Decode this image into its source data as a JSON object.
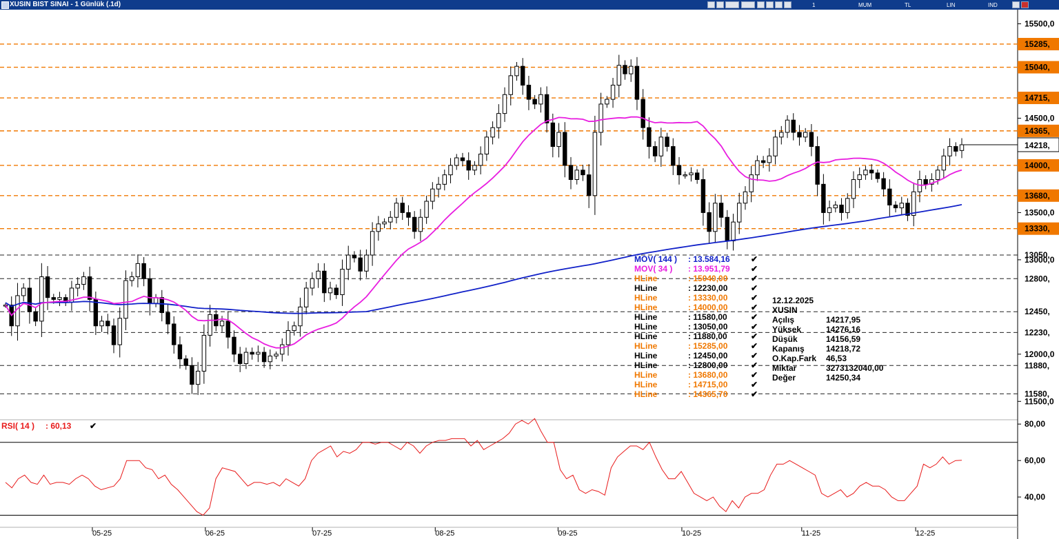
{
  "window": {
    "title": "XUSIN BIST SINAI - 1 Günlük (.1d)",
    "toolbar": {
      "period": "1 Günlük",
      "chart_type": "MUM",
      "currency": "TL",
      "scale": "LIN",
      "indicator_menu": "IND"
    }
  },
  "colors": {
    "mov144": "#1020c8",
    "mov34": "#e81ee0",
    "hline_orange": "#f07800",
    "hline_black": "#000000",
    "price_tag_orange": "#f07800",
    "rsi": "#e81a1a",
    "title_bar": "#0f3c8c"
  },
  "price_axis": {
    "ticks": [
      "15500,0",
      "14500,0",
      "13500,0",
      "13000,0",
      "12000,0",
      "11500,0"
    ],
    "last_price_tag": "14218,"
  },
  "hline_tags": [
    {
      "label": "15285,",
      "color": "orange"
    },
    {
      "label": "15040,",
      "color": "orange"
    },
    {
      "label": "14715,",
      "color": "orange"
    },
    {
      "label": "14365,",
      "color": "orange"
    },
    {
      "label": "14000,",
      "color": "orange"
    },
    {
      "label": "13680,",
      "color": "orange"
    },
    {
      "label": "13330,",
      "color": "orange"
    },
    {
      "label": "13050,",
      "color": "black"
    },
    {
      "label": "12800,",
      "color": "black"
    },
    {
      "label": "12450,",
      "color": "black"
    },
    {
      "label": "12230,",
      "color": "black"
    },
    {
      "label": "11880,",
      "color": "black"
    },
    {
      "label": "11580,",
      "color": "black"
    }
  ],
  "legend": [
    {
      "name": "MOV( 144 )",
      "value": ": 13.584,16",
      "color": "blue"
    },
    {
      "name": "MOV( 34 )",
      "value": ": 13.951,79",
      "color": "magenta"
    },
    {
      "name": "HLine",
      "value": ": 15040,00",
      "color": "orange"
    },
    {
      "name": "HLine",
      "value": ": 12230,00",
      "color": "black"
    },
    {
      "name": "HLine",
      "value": ": 13330,00",
      "color": "orange"
    },
    {
      "name": "HLine",
      "value": ": 14000,00",
      "color": "orange"
    },
    {
      "name": "HLine",
      "value": ": 11580,00",
      "color": "black"
    },
    {
      "name": "HLine",
      "value": ": 13050,00",
      "color": "black"
    },
    {
      "name": "HLine",
      "value": ": 11880,00",
      "color": "black"
    },
    {
      "name": "HLine",
      "value": ": 15285,00",
      "color": "orange"
    },
    {
      "name": "HLine",
      "value": ": 12450,00",
      "color": "black"
    },
    {
      "name": "HLine",
      "value": ": 12800,00",
      "color": "black"
    },
    {
      "name": "HLine",
      "value": ": 13680,00",
      "color": "orange"
    },
    {
      "name": "HLine",
      "value": ": 14715,00",
      "color": "orange"
    },
    {
      "name": "HLine",
      "value": ": 14365,70",
      "color": "orange"
    }
  ],
  "info_box": {
    "date": "12.12.2025",
    "symbol": "XUSIN",
    "rows": [
      {
        "label": "Açılış",
        "value": "14217,95"
      },
      {
        "label": "Yüksek",
        "value": "14276,16"
      },
      {
        "label": "Düşük",
        "value": "14156,59"
      },
      {
        "label": "Kapanış",
        "value": "14218,72"
      },
      {
        "label": "O.Kap.Fark",
        "value": "46,53"
      },
      {
        "label": "Miktar",
        "value": "3273132040,00"
      },
      {
        "label": "Değer",
        "value": "14250,34"
      }
    ]
  },
  "rsi_panel": {
    "label": "RSI( 14 )",
    "value": ": 60,13",
    "ticks": [
      "80,00",
      "60,00",
      "40,00"
    ]
  },
  "date_axis": [
    "05-25",
    "06-25",
    "07-25",
    "08-25",
    "09-25",
    "10-25",
    "11-25",
    "12-25"
  ],
  "chart_data": {
    "type": "candlestick",
    "symbol": "XUSIN",
    "period": "1 Günlük",
    "price_ylim": [
      11400,
      15650
    ],
    "hlines": [
      15285,
      15040,
      14715,
      14365.7,
      14000,
      13680,
      13330,
      13050,
      12800,
      12450,
      12230,
      11880,
      11580
    ],
    "close": [
      12520,
      12300,
      12620,
      12700,
      12450,
      12350,
      12820,
      12600,
      12580,
      12600,
      12550,
      12700,
      12740,
      12820,
      12580,
      12300,
      12350,
      12300,
      12100,
      12380,
      12780,
      12820,
      12960,
      12800,
      12540,
      12600,
      12440,
      12320,
      12100,
      11950,
      11880,
      11680,
      11820,
      12200,
      12420,
      12300,
      12350,
      12180,
      12000,
      11900,
      12020,
      12000,
      12020,
      11920,
      11980,
      12000,
      12100,
      12250,
      12300,
      12500,
      12700,
      12800,
      12880,
      12650,
      12700,
      12630,
      12900,
      13050,
      13020,
      12880,
      13050,
      13300,
      13380,
      13400,
      13450,
      13600,
      13500,
      13450,
      13300,
      13450,
      13620,
      13750,
      13800,
      13900,
      14000,
      14080,
      14050,
      13950,
      14000,
      14120,
      14300,
      14400,
      14550,
      14750,
      14950,
      15050,
      14850,
      14700,
      14650,
      14750,
      14450,
      14200,
      14350,
      14000,
      13850,
      13950,
      13900,
      13680,
      14350,
      14650,
      14700,
      14850,
      15060,
      14970,
      15050,
      14700,
      14400,
      14200,
      14100,
      14300,
      14200,
      14000,
      13900,
      13900,
      13920,
      13850,
      13500,
      13300,
      13600,
      13450,
      13200,
      13400,
      13600,
      13720,
      13900,
      14050,
      14030,
      14100,
      14300,
      14350,
      14480,
      14350,
      14300,
      14350,
      14200,
      13800,
      13500,
      13550,
      13580,
      13500,
      13650,
      13850,
      13900,
      13950,
      13920,
      13860,
      13750,
      13580,
      13550,
      13600,
      13470,
      13720,
      13850,
      13800,
      13850,
      13950,
      14100,
      14200,
      14150,
      14218.72
    ],
    "ohlc_last": {
      "date": "12.12.2025",
      "open": 14217.95,
      "high": 14276.16,
      "low": 14156.59,
      "close": 14218.72
    },
    "series": [
      {
        "name": "MOV( 144 )",
        "last": 13584.16
      },
      {
        "name": "MOV( 34 )",
        "last": 13951.79
      }
    ],
    "rsi": {
      "name": "RSI( 14 )",
      "last": 60.13,
      "ylim": [
        20,
        85
      ],
      "levels": [
        70,
        30
      ],
      "values": [
        48,
        45,
        50,
        52,
        48,
        47,
        52,
        47,
        48,
        48,
        47,
        50,
        52,
        50,
        46,
        44,
        45,
        46,
        50,
        60,
        60,
        60,
        56,
        55,
        50,
        52,
        47,
        44,
        40,
        36,
        32,
        30,
        34,
        50,
        56,
        55,
        54,
        50,
        46,
        48,
        48,
        47,
        48,
        46,
        50,
        48,
        46,
        50,
        60,
        64,
        66,
        68,
        62,
        65,
        64,
        66,
        70,
        70,
        69,
        70,
        70,
        68,
        66,
        70,
        68,
        64,
        68,
        70,
        71,
        71,
        72,
        72,
        72,
        68,
        71,
        66,
        68,
        70,
        72,
        75,
        80,
        82,
        80,
        83,
        76,
        70,
        70,
        55,
        50,
        52,
        44,
        42,
        44,
        43,
        41,
        56,
        62,
        65,
        68,
        68,
        66,
        70,
        62,
        55,
        50,
        50,
        54,
        48,
        42,
        40,
        38,
        40,
        35,
        32,
        38,
        34,
        40,
        42,
        42,
        44,
        52,
        58,
        58,
        60,
        58,
        56,
        54,
        52,
        42,
        40,
        42,
        44,
        40,
        42,
        46,
        48,
        46,
        46,
        44,
        40,
        38,
        38,
        42,
        46,
        58,
        56,
        58,
        62,
        58,
        60,
        60.13
      ]
    }
  }
}
